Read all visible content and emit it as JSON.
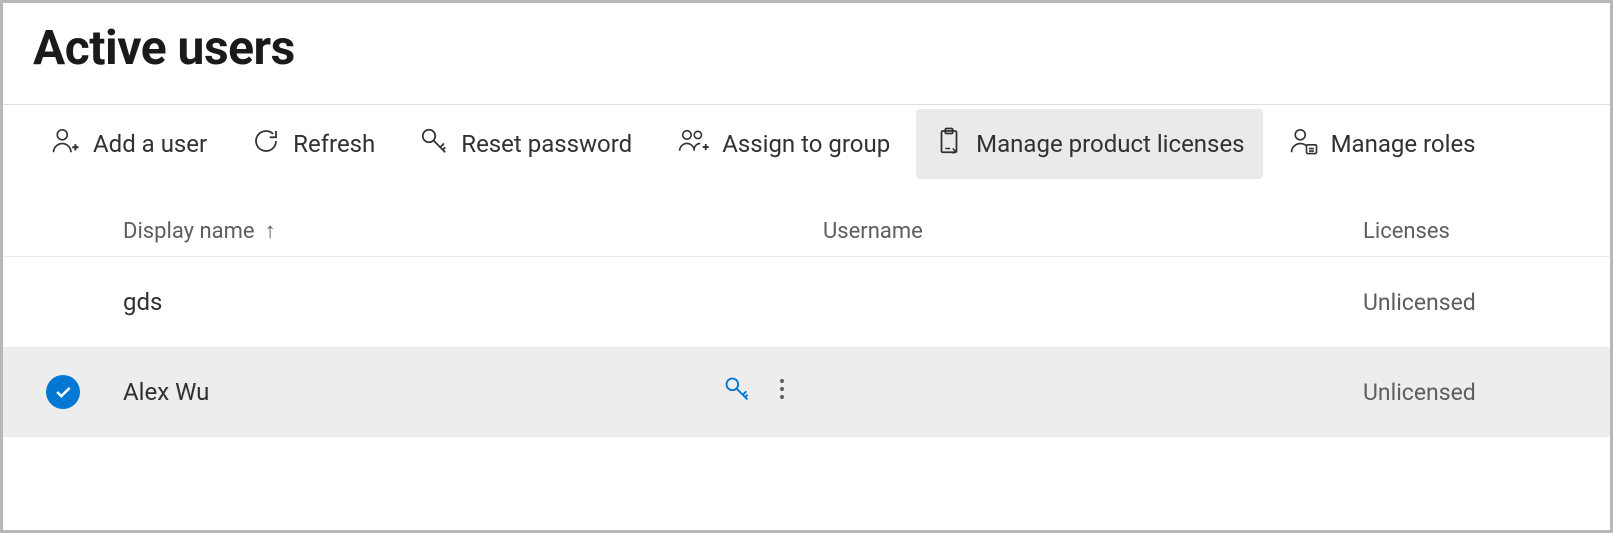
{
  "page": {
    "title": "Active users"
  },
  "toolbar": {
    "items": [
      {
        "label": "Add a user"
      },
      {
        "label": "Refresh"
      },
      {
        "label": "Reset password"
      },
      {
        "label": "Assign to group"
      },
      {
        "label": "Manage product licenses"
      },
      {
        "label": "Manage roles"
      }
    ]
  },
  "columns": {
    "display_name": "Display name",
    "username": "Username",
    "licenses": "Licenses"
  },
  "rows": [
    {
      "selected": false,
      "display_name": "gds",
      "username": "",
      "licenses": "Unlicensed"
    },
    {
      "selected": true,
      "display_name": "Alex Wu",
      "username": "",
      "licenses": "Unlicensed"
    }
  ]
}
